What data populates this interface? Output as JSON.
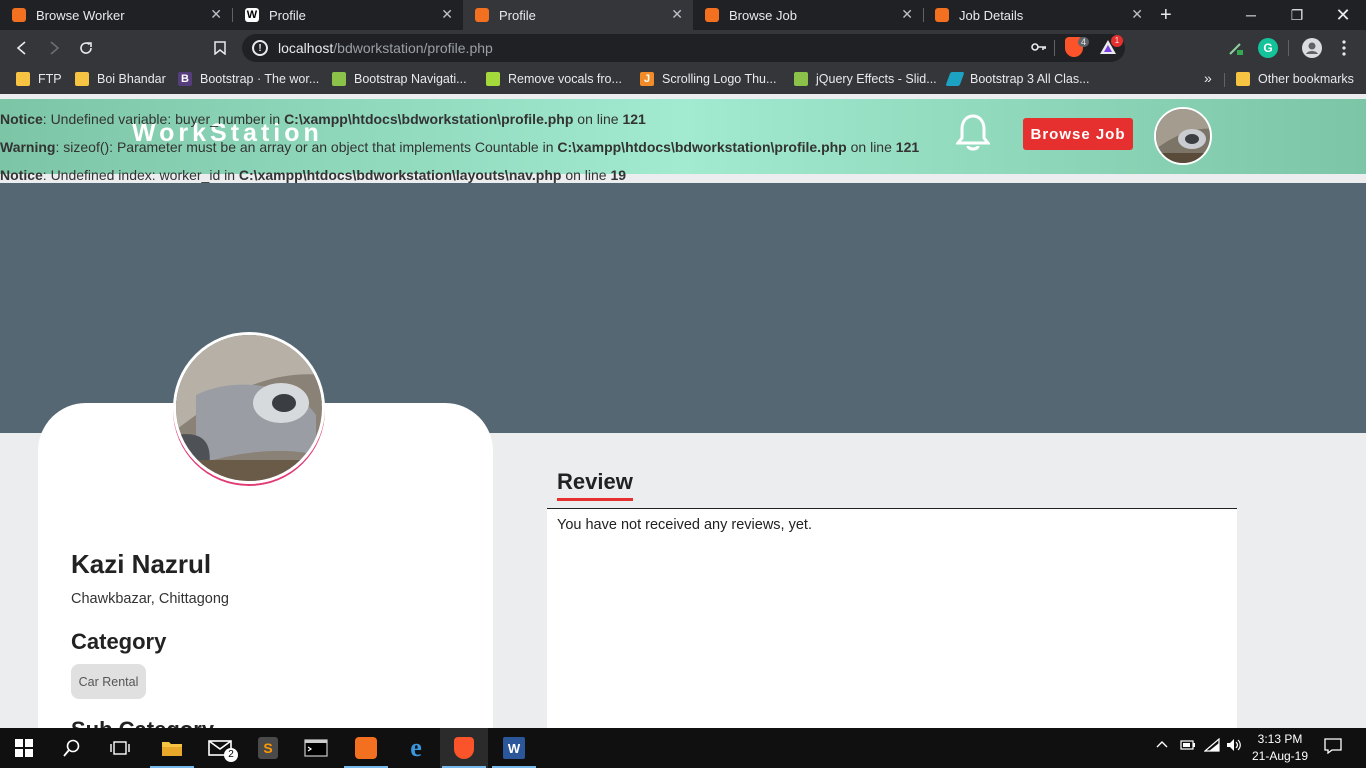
{
  "browser": {
    "tabs": [
      {
        "title": "Browse Worker",
        "active": false
      },
      {
        "title": "Profile",
        "active": false
      },
      {
        "title": "Profile",
        "active": true
      },
      {
        "title": "Browse Job",
        "active": false
      },
      {
        "title": "Job Details",
        "active": false
      }
    ],
    "new_tab": "+",
    "url_host": "localhost",
    "url_path": "/bdworkstation/profile.php",
    "brave_badge": "4",
    "rewards_badge": "1",
    "bookmarks": [
      "FTP",
      "Boi Bhandar",
      "Bootstrap · The wor...",
      "Bootstrap Navigati...",
      "Remove vocals fro...",
      "Scrolling Logo Thu...",
      "jQuery Effects - Slid...",
      "Bootstrap 3 All Clas..."
    ],
    "bookmarks_more": "»",
    "other_bookmarks": "Other bookmarks"
  },
  "site": {
    "brand": "WorkStation",
    "browse_job_button": "Browse Job",
    "errors": [
      {
        "level": "Notice",
        "message": ": Undefined variable: buyer_number in ",
        "file": "C:\\xampp\\htdocs\\bdworkstation\\profile.php",
        "on_line": " on line ",
        "line": "121"
      },
      {
        "level": "Warning",
        "message": ": sizeof(): Parameter must be an array or an object that implements Countable in ",
        "file": "C:\\xampp\\htdocs\\bdworkstation\\profile.php",
        "on_line": " on line ",
        "line": "121"
      },
      {
        "level": "Notice",
        "message": ": Undefined index: worker_id in ",
        "file": "C:\\xampp\\htdocs\\bdworkstation\\layouts\\nav.php",
        "on_line": " on line ",
        "line": "19"
      }
    ]
  },
  "profile": {
    "name": "Kazi Nazrul",
    "location": "Chawkbazar, Chittagong",
    "category_heading": "Category",
    "category_chip": "Car Rental",
    "subcategory_heading": "Sub Category"
  },
  "review": {
    "title": "Review",
    "empty_text": "You have not received any reviews, yet."
  },
  "taskbar": {
    "mail_badge": "2",
    "time": "3:13 PM",
    "date": "21-Aug-19"
  },
  "colors": {
    "accent_red": "#e5302f",
    "navbar_green": "#7cc5a6",
    "cover_slate": "#546773"
  }
}
